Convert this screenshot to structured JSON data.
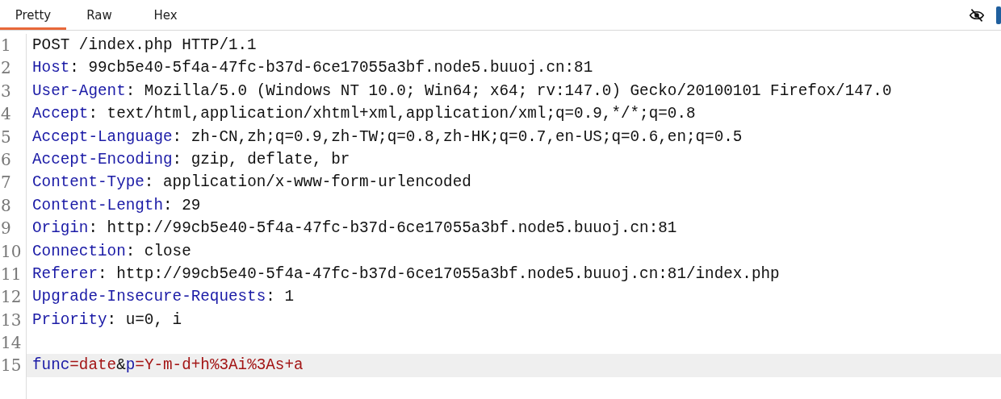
{
  "tabs": [
    {
      "label": "Pretty",
      "selected": true
    },
    {
      "label": "Raw",
      "selected": false
    },
    {
      "label": "Hex",
      "selected": false
    }
  ],
  "editor": {
    "lines": [
      {
        "number": "1",
        "active": false,
        "segments": [
          {
            "kind": "plain",
            "text": "POST /index.php HTTP/1.1"
          }
        ]
      },
      {
        "number": "2",
        "active": false,
        "segments": [
          {
            "kind": "key",
            "text": "Host"
          },
          {
            "kind": "plain",
            "text": ": 99cb5e40-5f4a-47fc-b37d-6ce17055a3bf.node5.buuoj.cn:81"
          }
        ]
      },
      {
        "number": "3",
        "active": false,
        "segments": [
          {
            "kind": "key",
            "text": "User-Agent"
          },
          {
            "kind": "plain",
            "text": ": Mozilla/5.0 (Windows NT 10.0; Win64; x64; rv:147.0) Gecko/20100101 Firefox/147.0"
          }
        ]
      },
      {
        "number": "4",
        "active": false,
        "segments": [
          {
            "kind": "key",
            "text": "Accept"
          },
          {
            "kind": "plain",
            "text": ": text/html,application/xhtml+xml,application/xml;q=0.9,*/*;q=0.8"
          }
        ]
      },
      {
        "number": "5",
        "active": false,
        "segments": [
          {
            "kind": "key",
            "text": "Accept-Language"
          },
          {
            "kind": "plain",
            "text": ": zh-CN,zh;q=0.9,zh-TW;q=0.8,zh-HK;q=0.7,en-US;q=0.6,en;q=0.5"
          }
        ]
      },
      {
        "number": "6",
        "active": false,
        "segments": [
          {
            "kind": "key",
            "text": "Accept-Encoding"
          },
          {
            "kind": "plain",
            "text": ": gzip, deflate, br"
          }
        ]
      },
      {
        "number": "7",
        "active": false,
        "segments": [
          {
            "kind": "key",
            "text": "Content-Type"
          },
          {
            "kind": "plain",
            "text": ": application/x-www-form-urlencoded"
          }
        ]
      },
      {
        "number": "8",
        "active": false,
        "segments": [
          {
            "kind": "key",
            "text": "Content-Length"
          },
          {
            "kind": "plain",
            "text": ": 29"
          }
        ]
      },
      {
        "number": "9",
        "active": false,
        "segments": [
          {
            "kind": "key",
            "text": "Origin"
          },
          {
            "kind": "plain",
            "text": ": http://99cb5e40-5f4a-47fc-b37d-6ce17055a3bf.node5.buuoj.cn:81"
          }
        ]
      },
      {
        "number": "10",
        "active": false,
        "segments": [
          {
            "kind": "key",
            "text": "Connection"
          },
          {
            "kind": "plain",
            "text": ": close"
          }
        ]
      },
      {
        "number": "11",
        "active": false,
        "segments": [
          {
            "kind": "key",
            "text": "Referer"
          },
          {
            "kind": "plain",
            "text": ": http://99cb5e40-5f4a-47fc-b37d-6ce17055a3bf.node5.buuoj.cn:81/index.php"
          }
        ]
      },
      {
        "number": "12",
        "active": false,
        "segments": [
          {
            "kind": "key",
            "text": "Upgrade-Insecure-Requests"
          },
          {
            "kind": "plain",
            "text": ": 1"
          }
        ]
      },
      {
        "number": "13",
        "active": false,
        "segments": [
          {
            "kind": "key",
            "text": "Priority"
          },
          {
            "kind": "plain",
            "text": ": u=0, i"
          }
        ]
      },
      {
        "number": "14",
        "active": false
      },
      {
        "number": "15",
        "active": true,
        "segments": [
          {
            "kind": "key",
            "text": "func"
          },
          {
            "kind": "value",
            "text": "=date"
          },
          {
            "kind": "plain",
            "text": "&"
          },
          {
            "kind": "key",
            "text": "p"
          },
          {
            "kind": "value",
            "text": "=Y-m-d+h%3Ai%3As+a"
          }
        ]
      }
    ]
  }
}
